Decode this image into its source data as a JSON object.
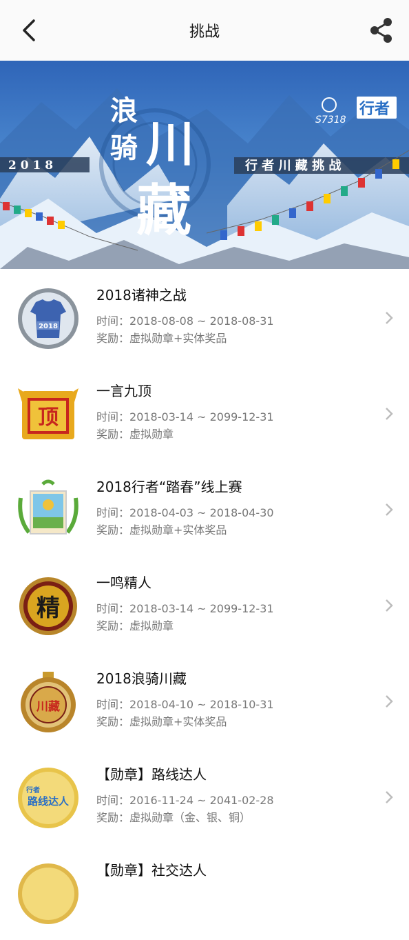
{
  "header": {
    "title": "挑战",
    "back_icon": "chevron-left-icon",
    "share_icon": "share-icon"
  },
  "banner": {
    "year": "2 0 1 8",
    "calligraphy": [
      "浪",
      "骑",
      "川",
      "藏"
    ],
    "subtitle": "行 者 川 藏 挑 战",
    "logo_text": "行者",
    "logo_number": "S7318"
  },
  "labels": {
    "time": "时间：",
    "reward": "奖励："
  },
  "challenges": [
    {
      "title": "2018诸神之战",
      "time": "2018-08-08 ~ 2018-08-31",
      "reward": "虚拟勋章+实体奖品",
      "badge_text": "2018"
    },
    {
      "title": "一言九顶",
      "time": "2018-03-14 ~ 2099-12-31",
      "reward": "虚拟勋章",
      "badge_text": "顶"
    },
    {
      "title": "2018行者“踏春”线上赛",
      "time": "2018-04-03 ~ 2018-04-30",
      "reward": "虚拟勋章+实体奖品",
      "badge_text": ""
    },
    {
      "title": "一鸣精人",
      "time": "2018-03-14 ~ 2099-12-31",
      "reward": "虚拟勋章",
      "badge_text": "精"
    },
    {
      "title": "2018浪骑川藏",
      "time": "2018-04-10 ~ 2018-10-31",
      "reward": "虚拟勋章+实体奖品",
      "badge_text": "川藏"
    },
    {
      "title": "【勋章】路线达人",
      "time": "2016-11-24 ~ 2041-02-28",
      "reward": "虚拟勋章（金、银、铜）",
      "badge_text": "路线达人",
      "badge_top": "行者"
    },
    {
      "title": "【勋章】社交达人",
      "time": "",
      "reward": "",
      "badge_text": ""
    }
  ],
  "colors": {
    "accent_gold": "#d9a520",
    "jersey_blue": "#3d63b0",
    "sky_blue": "#2b5fa8",
    "chevron": "#bcbcbc"
  }
}
